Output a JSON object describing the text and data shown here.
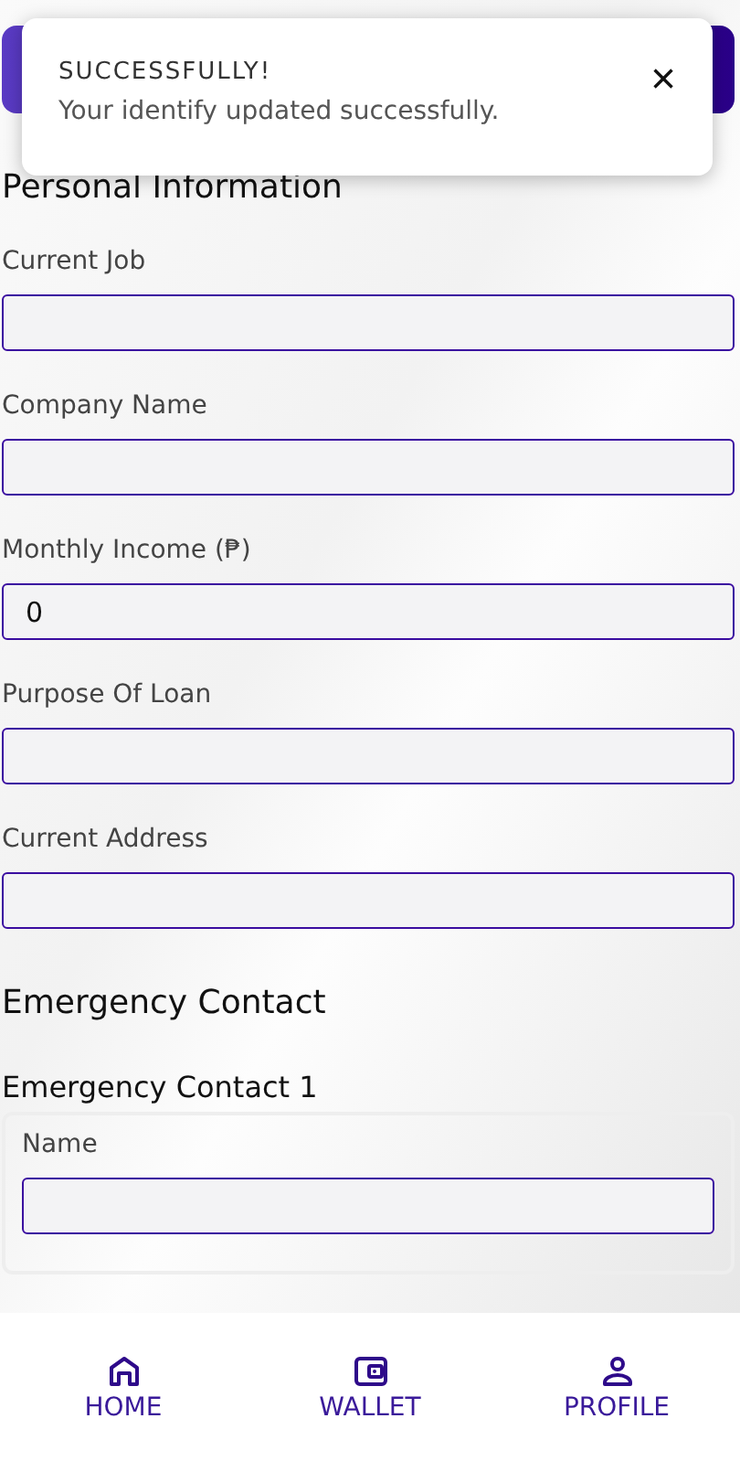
{
  "toast": {
    "title": "SUCCESSFULLY!",
    "message": "Your identify updated successfully.",
    "close": "×"
  },
  "personal": {
    "heading": "Personal Information",
    "fields": [
      {
        "label": "Current Job"
      },
      {
        "label": "Company Name"
      },
      {
        "label": "Monthly Income (₱)",
        "value": "0"
      },
      {
        "label": "Purpose Of Loan"
      },
      {
        "label": "Current Address"
      }
    ]
  },
  "emergency": {
    "heading": "Emergency Contact",
    "contacts": [
      {
        "title": "Emergency Contact 1",
        "fields": [
          {
            "label": "Name"
          }
        ]
      }
    ]
  },
  "nav": [
    {
      "kind": "home",
      "label": "HOME"
    },
    {
      "kind": "wallet",
      "label": "WALLET"
    },
    {
      "kind": "profile",
      "label": "PROFILE"
    }
  ]
}
